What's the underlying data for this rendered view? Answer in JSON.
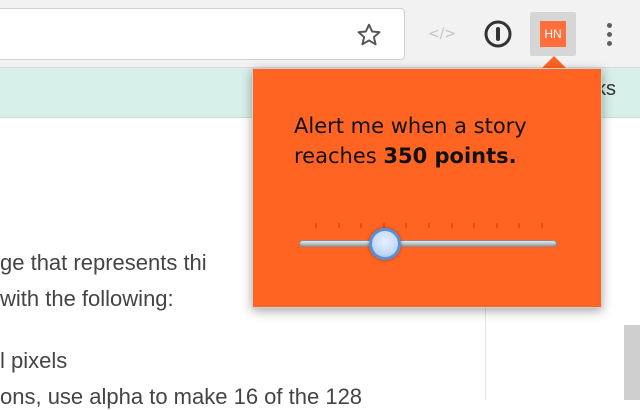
{
  "toolbar": {
    "icons": [
      "star-icon",
      "code-icon",
      "password-icon",
      "hn-extension-icon",
      "menu-icon"
    ],
    "code_icon_text": "</>",
    "hn_logo_text": "HN"
  },
  "bookmarks": {
    "visible_text": "ks"
  },
  "page_text": {
    "lines": [
      "ge that represents thi",
      "with the following:",
      "l pixels",
      "ons, use alpha to make 16 of the 128"
    ]
  },
  "popup": {
    "message_prefix": "Alert me when a story reaches ",
    "points": "350",
    "points_suffix": " points.",
    "slider": {
      "fraction": 0.31
    },
    "colors": {
      "background": "#ff6422",
      "thumb_border": "#5b90d8"
    }
  }
}
